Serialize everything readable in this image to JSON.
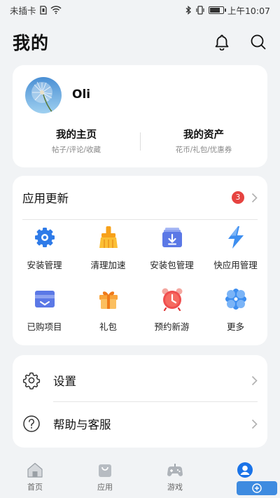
{
  "status_bar": {
    "carrier": "未插卡",
    "time": "上午10:07"
  },
  "header": {
    "title": "我的"
  },
  "profile": {
    "username": "Oli",
    "links": [
      {
        "title": "我的主页",
        "subtitle": "帖子/评论/收藏"
      },
      {
        "title": "我的资产",
        "subtitle": "花币/礼包/优惠券"
      }
    ]
  },
  "apps": {
    "title": "应用更新",
    "badge_count": "3",
    "items": [
      {
        "label": "安装管理",
        "icon": "gear-icon"
      },
      {
        "label": "清理加速",
        "icon": "broom-icon"
      },
      {
        "label": "安装包管理",
        "icon": "package-icon"
      },
      {
        "label": "快应用管理",
        "icon": "lightning-icon"
      },
      {
        "label": "已购项目",
        "icon": "purchased-icon"
      },
      {
        "label": "礼包",
        "icon": "gift-icon"
      },
      {
        "label": "预约新游",
        "icon": "alarm-clock-icon"
      },
      {
        "label": "更多",
        "icon": "more-icon"
      }
    ]
  },
  "settings": {
    "items": [
      {
        "label": "设置",
        "icon": "settings-icon"
      },
      {
        "label": "帮助与客服",
        "icon": "help-icon"
      }
    ]
  },
  "tabs": [
    {
      "label": "首页",
      "icon": "home-icon"
    },
    {
      "label": "应用",
      "icon": "apps-icon"
    },
    {
      "label": "游戏",
      "icon": "gamepad-icon"
    },
    {
      "label": "",
      "icon": "profile-icon",
      "active": true
    }
  ],
  "colors": {
    "accent": "#1a73e8",
    "badge": "#e64340",
    "background": "#f1f3f5"
  },
  "battery_level": 0.8
}
